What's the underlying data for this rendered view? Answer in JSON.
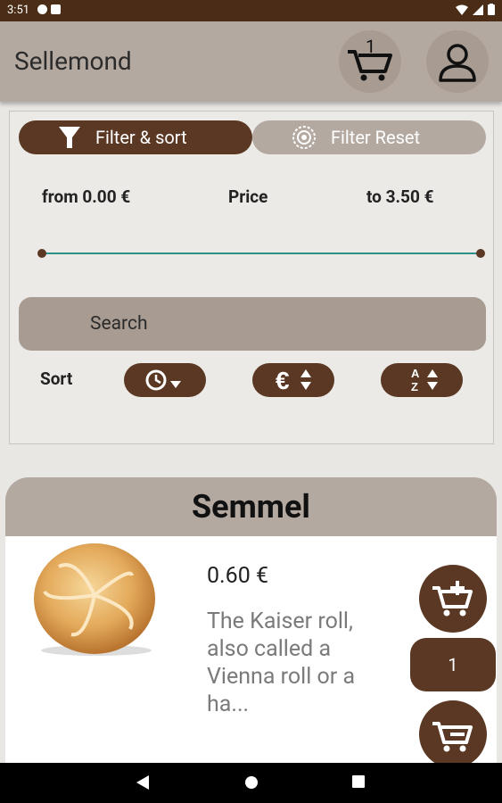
{
  "status_bar": {
    "time": "3:51"
  },
  "app": {
    "title": "Sellemond",
    "cart_count": "1"
  },
  "filter": {
    "filter_sort_label": "Filter & sort",
    "filter_reset_label": "Filter Reset",
    "price_from": "from 0.00 €",
    "price_label": "Price",
    "price_to": "to 3.50 €",
    "search_placeholder": "Search",
    "sort_label": "Sort",
    "sort_buttons": [
      "sort-by-time-icon",
      "sort-by-price-icon",
      "sort-alphabetical-icon"
    ]
  },
  "product": {
    "title": "Semmel",
    "price": "0.60 €",
    "description": "The Kaiser roll, also called a Vienna roll or a ha...",
    "quantity": "1"
  },
  "colors": {
    "brown": "#5a3823",
    "taupe": "#b4a9a0",
    "teal": "#2d8f86",
    "statusbar": "#4a2c17"
  }
}
